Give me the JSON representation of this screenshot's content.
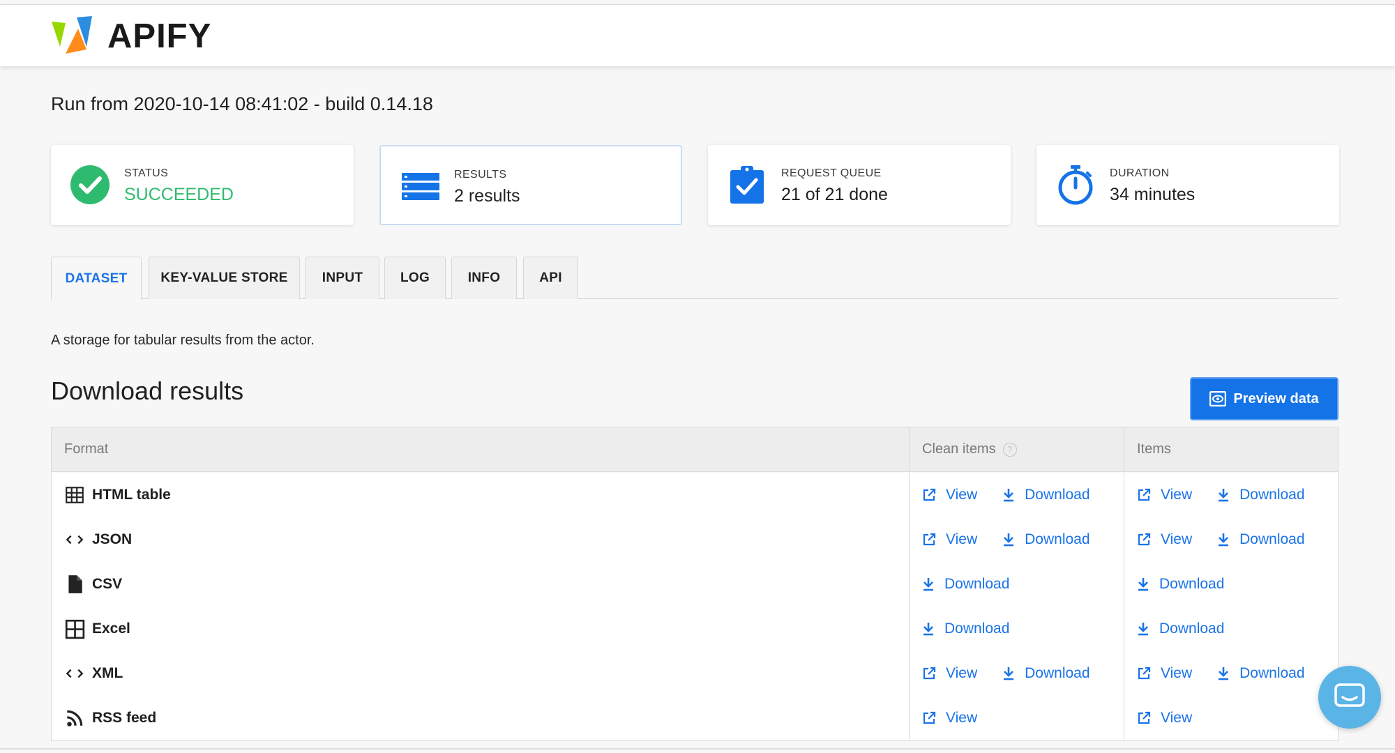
{
  "brand": {
    "name": "APIFY"
  },
  "run": {
    "title": "Run from 2020-10-14 08:41:02 - build 0.14.18"
  },
  "stats": [
    {
      "label": "STATUS",
      "value": "SUCCEEDED",
      "icon": "check-circle-icon",
      "color": "#2fbb6f"
    },
    {
      "label": "RESULTS",
      "value": "2 results",
      "icon": "dataset-icon",
      "color": "#1573e8"
    },
    {
      "label": "REQUEST QUEUE",
      "value": "21 of 21 done",
      "icon": "clipboard-check-icon",
      "color": "#1573e8"
    },
    {
      "label": "DURATION",
      "value": "34 minutes",
      "icon": "stopwatch-icon",
      "color": "#1573e8"
    }
  ],
  "tabs": [
    {
      "label": "DATASET",
      "active": true
    },
    {
      "label": "KEY-VALUE STORE"
    },
    {
      "label": "INPUT"
    },
    {
      "label": "LOG"
    },
    {
      "label": "INFO"
    },
    {
      "label": "API"
    }
  ],
  "dataset": {
    "description": "A storage for tabular results from the actor.",
    "section_title": "Download results",
    "preview_button": "Preview data",
    "help_glyph": "?",
    "columns": {
      "format": "Format",
      "clean": "Clean items",
      "items": "Items"
    },
    "link_labels": {
      "view": "View",
      "download": "Download"
    },
    "rows": [
      {
        "format": "HTML table",
        "icon": "table-grid-icon",
        "view": true,
        "download": true
      },
      {
        "format": "JSON",
        "icon": "code-brackets-icon",
        "view": true,
        "download": true
      },
      {
        "format": "CSV",
        "icon": "file-icon",
        "view": false,
        "download": true
      },
      {
        "format": "Excel",
        "icon": "excel-grid-icon",
        "view": false,
        "download": true
      },
      {
        "format": "XML",
        "icon": "code-brackets-icon",
        "view": true,
        "download": true
      },
      {
        "format": "RSS feed",
        "icon": "rss-icon",
        "view": true,
        "download": false
      }
    ]
  },
  "colors": {
    "accent": "#1a73e8",
    "success": "#2fbb6f",
    "chat": "#5ab4e6"
  }
}
